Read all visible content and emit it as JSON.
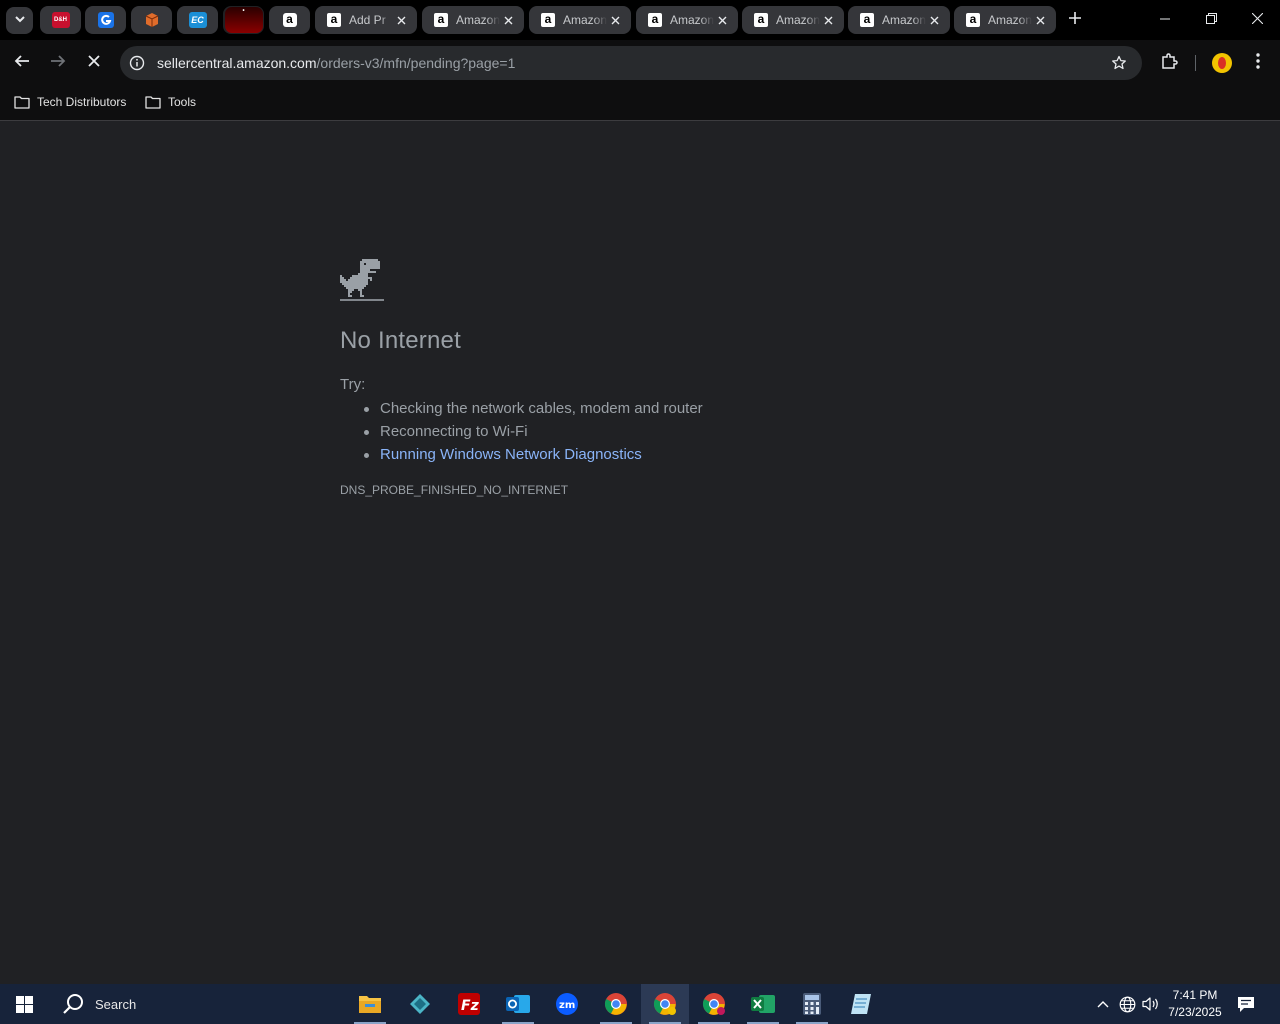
{
  "browser": {
    "pinned_tabs": [
      {
        "name": "pinned-tab-1",
        "icon": "red-logo-icon",
        "label": "D&H",
        "color": "#c8102e"
      },
      {
        "name": "pinned-tab-2",
        "icon": "blue-g-icon",
        "label": "",
        "color": "#1a73e8"
      },
      {
        "name": "pinned-tab-3",
        "icon": "package-icon",
        "label": "",
        "color": "#e06c2b"
      },
      {
        "name": "pinned-tab-4",
        "icon": "ec-icon",
        "label": "EC",
        "color": "#1b8fd6"
      },
      {
        "name": "pinned-tab-5",
        "icon": "red-dark-icon",
        "label": "",
        "color": "#6b0000"
      },
      {
        "name": "pinned-tab-6",
        "icon": "amazon-icon",
        "label": "",
        "color": "#ffffff"
      }
    ],
    "tabs": [
      {
        "title": "Add Pr"
      },
      {
        "title": "Amazon"
      },
      {
        "title": "Amazon"
      },
      {
        "title": "Amazon"
      },
      {
        "title": "Amazon"
      },
      {
        "title": "Amazon"
      },
      {
        "title": "Amazon"
      }
    ],
    "address": {
      "host": "sellercentral.amazon.com",
      "path": "/orders-v3/mfn/pending?page=1"
    },
    "bookmarks": [
      {
        "label": "Tech Distributors"
      },
      {
        "label": "Tools"
      }
    ]
  },
  "error_page": {
    "title": "No Internet",
    "try_label": "Try:",
    "suggestions": [
      "Checking the network cables, modem and router",
      "Reconnecting to Wi-Fi"
    ],
    "link_suggestion": "Running Windows Network Diagnostics",
    "error_code": "DNS_PROBE_FINISHED_NO_INTERNET"
  },
  "taskbar": {
    "search_label": "Search",
    "time": "7:41 PM",
    "date": "7/23/2025"
  }
}
